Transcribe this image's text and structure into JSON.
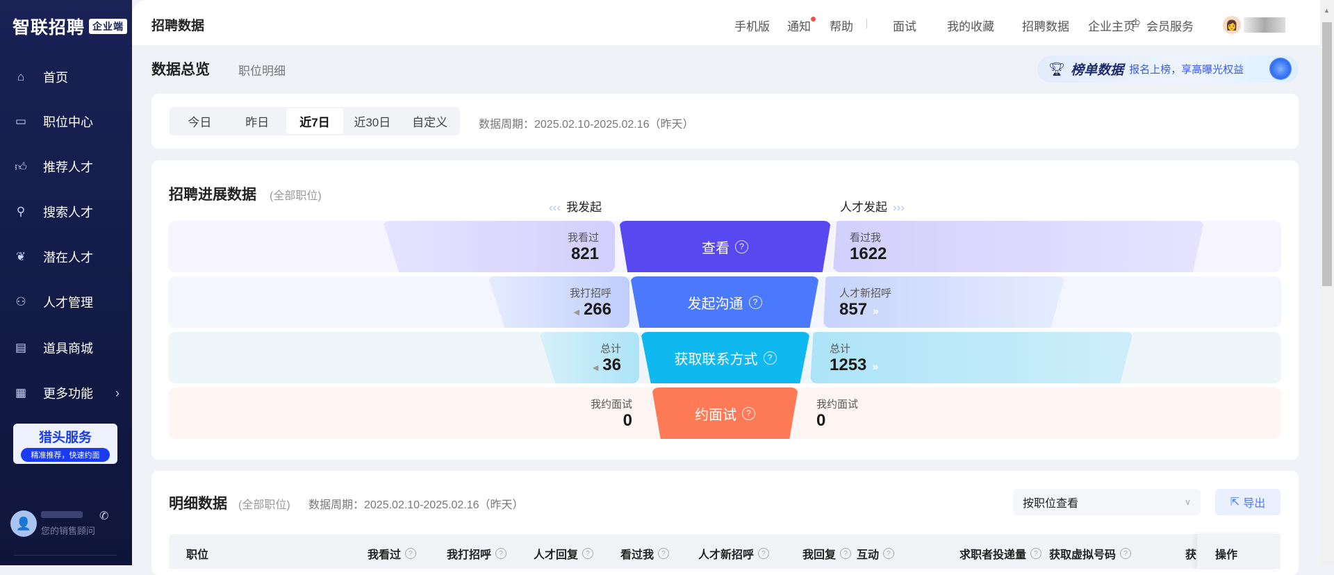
{
  "sidebar": {
    "logo": "智联招聘",
    "logo_tag": "企业端",
    "items": [
      {
        "label": "首页",
        "icon": "home-icon"
      },
      {
        "label": "职位中心",
        "icon": "briefcase-icon"
      },
      {
        "label": "推荐人才",
        "icon": "thumbs-up-icon"
      },
      {
        "label": "搜索人才",
        "icon": "search-icon"
      },
      {
        "label": "潜在人才",
        "icon": "sprout-icon"
      },
      {
        "label": "人才管理",
        "icon": "users-icon"
      },
      {
        "label": "道具商城",
        "icon": "store-icon"
      },
      {
        "label": "更多功能",
        "icon": "grid-icon"
      }
    ],
    "promo_title": "猎头服务",
    "promo_sub": "精准推荐，快速约面",
    "advisor_label": "您的销售顾问"
  },
  "header": {
    "title": "招聘数据",
    "nav": [
      "手机版",
      "通知",
      "帮助",
      "面试",
      "我的收藏",
      "招聘数据",
      "企业主页",
      "会员服务"
    ]
  },
  "subtabs": {
    "overview": "数据总览",
    "detail": "职位明细"
  },
  "banner": {
    "title": "榜单数据",
    "text": "报名上榜，享高曝光权益"
  },
  "date_filter": {
    "tabs": [
      "今日",
      "昨日",
      "近7日",
      "近30日",
      "自定义"
    ],
    "active": "近7日",
    "period": "数据周期：2025.02.10-2025.02.16（昨天）"
  },
  "funnel": {
    "title": "招聘进展数据",
    "scope": "(全部职位)",
    "left_head": "我发起",
    "right_head": "人才发起",
    "rows": [
      {
        "stage": "查看",
        "left_label": "我看过",
        "left_value": "821",
        "right_label": "看过我",
        "right_value": "1622",
        "color": "#5748f0"
      },
      {
        "stage": "发起沟通",
        "left_label": "我打招呼",
        "left_value": "266",
        "right_label": "人才新招呼",
        "right_value": "857",
        "color": "#4a79fb"
      },
      {
        "stage": "获取联系方式",
        "left_label": "总计",
        "left_value": "36",
        "right_label": "总计",
        "right_value": "1253",
        "color": "#0fb9ef"
      },
      {
        "stage": "约面试",
        "left_label": "我约面试",
        "left_value": "0",
        "right_label": "我约面试",
        "right_value": "0",
        "color": "#ff7b58"
      }
    ]
  },
  "detail": {
    "title": "明细数据",
    "scope": "(全部职位)",
    "period": "数据周期：2025.02.10-2025.02.16（昨天）",
    "view_select": "按职位查看",
    "export": "导出",
    "columns": [
      "职位",
      "我看过",
      "我打招呼",
      "人才回复",
      "看过我",
      "人才新招呼",
      "我回复",
      "互动",
      "求职者投递量",
      "获取虚拟号码",
      "获",
      "操作"
    ]
  }
}
